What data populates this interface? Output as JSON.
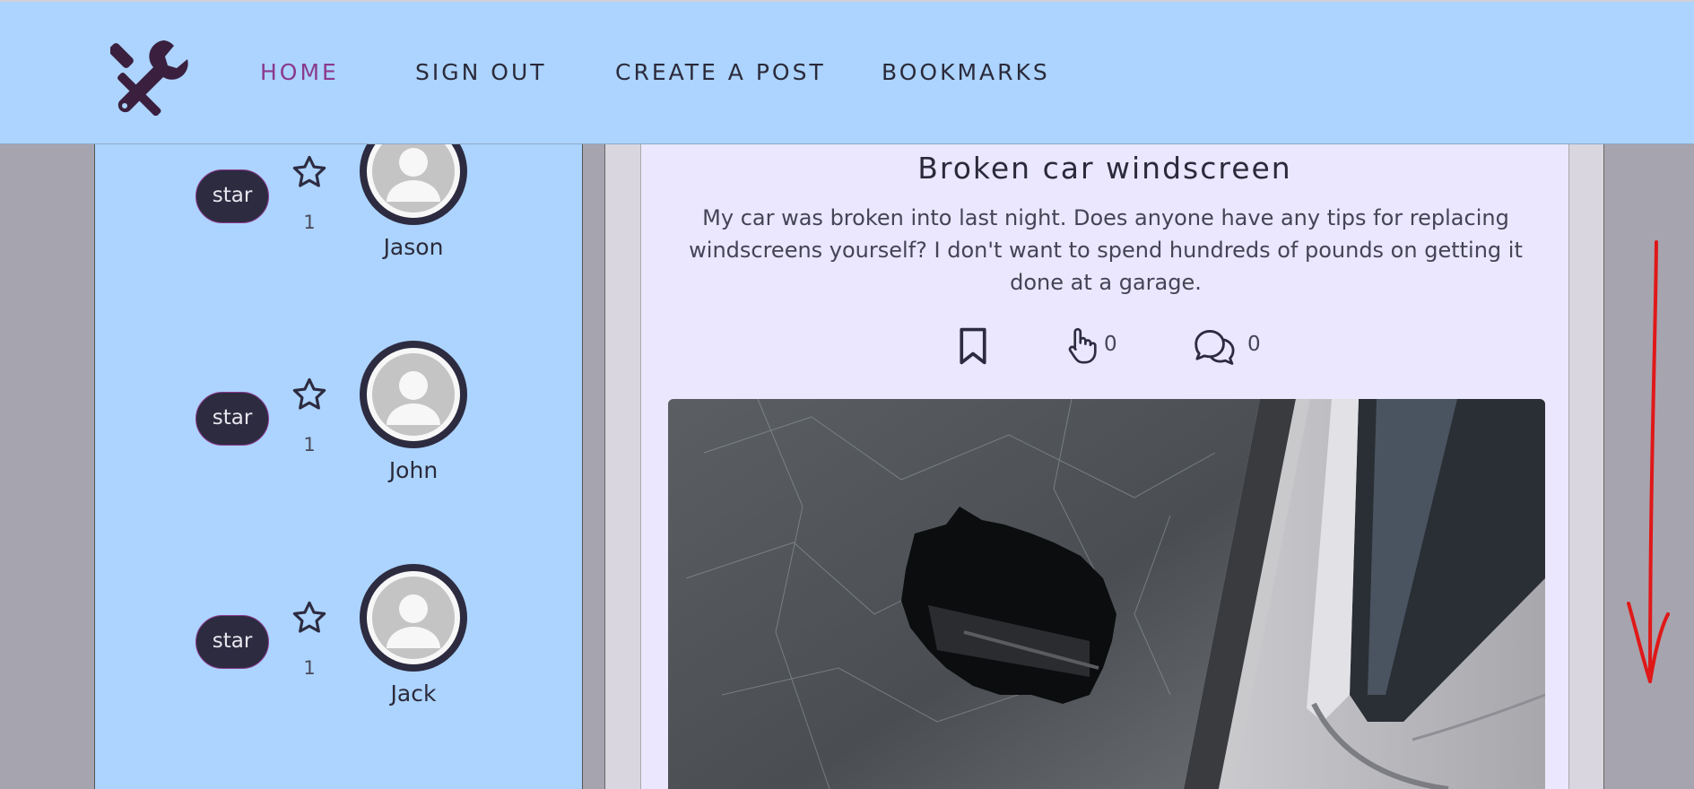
{
  "nav": {
    "logo_icon": "wrench-screwdriver-icon",
    "links": [
      {
        "label": "HOME",
        "active": true
      },
      {
        "label": "SIGN OUT",
        "active": false
      },
      {
        "label": "CREATE A POST",
        "active": false
      },
      {
        "label": "BOOKMARKS",
        "active": false
      }
    ]
  },
  "sidebar": {
    "users": [
      {
        "star_button": "star",
        "star_count": "1",
        "name": "Jason"
      },
      {
        "star_button": "star",
        "star_count": "1",
        "name": "John"
      },
      {
        "star_button": "star",
        "star_count": "1",
        "name": "Jack"
      }
    ]
  },
  "post": {
    "title": "Broken car windscreen",
    "body": "My car was broken into last night. Does anyone have any tips for replacing windscreens yourself? I don't want to spend hundreds of pounds on getting it done at a garage.",
    "like_count": "0",
    "comment_count": "0",
    "image_alt": "broken car window"
  },
  "colors": {
    "header_bg": "#acd4ff",
    "accent_active": "#8a3a8c",
    "dark": "#2d2b40",
    "post_bg": "#eae7ff",
    "annotation_arrow": "#e01818"
  }
}
